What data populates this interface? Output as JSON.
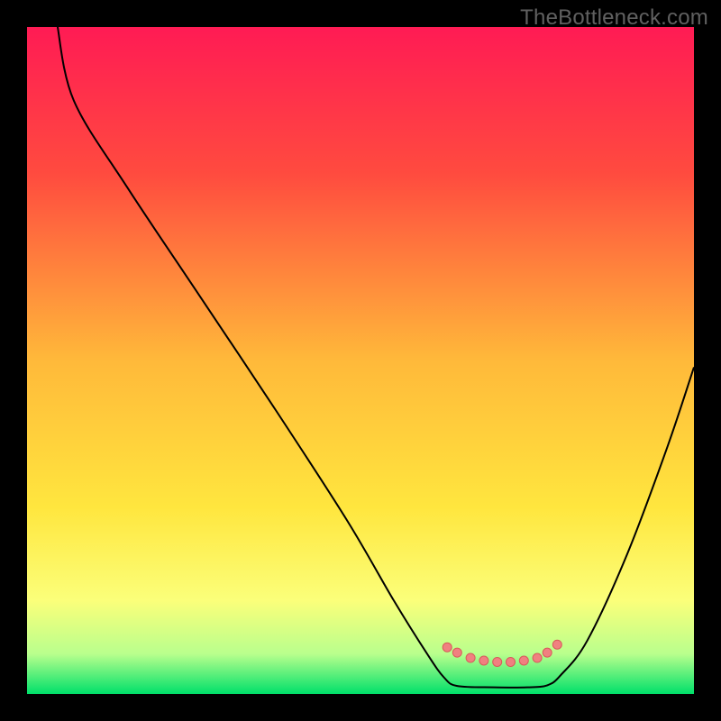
{
  "watermark": {
    "text": "TheBottleneck.com"
  },
  "chart_data": {
    "type": "line",
    "title": "",
    "xlabel": "",
    "ylabel": "",
    "xlim": [
      0,
      100
    ],
    "ylim": [
      0,
      100
    ],
    "background": {
      "type": "vertical-gradient",
      "stops": [
        {
          "pct": 0,
          "color": "#ff1b54"
        },
        {
          "pct": 22,
          "color": "#ff4b3f"
        },
        {
          "pct": 50,
          "color": "#ffb93a"
        },
        {
          "pct": 72,
          "color": "#ffe63e"
        },
        {
          "pct": 86,
          "color": "#fbff7a"
        },
        {
          "pct": 94,
          "color": "#b9ff8d"
        },
        {
          "pct": 100,
          "color": "#00e06a"
        }
      ]
    },
    "series": [
      {
        "name": "bottleneck-curve",
        "color": "#000000",
        "width": 2,
        "points": [
          {
            "x": 4.5,
            "y": 100.5
          },
          {
            "x": 7,
            "y": 89
          },
          {
            "x": 15,
            "y": 76
          },
          {
            "x": 25,
            "y": 61
          },
          {
            "x": 37,
            "y": 43
          },
          {
            "x": 48,
            "y": 26
          },
          {
            "x": 55,
            "y": 14
          },
          {
            "x": 60,
            "y": 6
          },
          {
            "x": 62.5,
            "y": 2.5
          },
          {
            "x": 64.5,
            "y": 1.2
          },
          {
            "x": 70,
            "y": 1.0
          },
          {
            "x": 75,
            "y": 1.0
          },
          {
            "x": 78,
            "y": 1.3
          },
          {
            "x": 80,
            "y": 2.8
          },
          {
            "x": 84,
            "y": 8
          },
          {
            "x": 90,
            "y": 21
          },
          {
            "x": 96,
            "y": 37
          },
          {
            "x": 100,
            "y": 49
          }
        ]
      }
    ],
    "markers": {
      "fill": "#f08080",
      "stroke": "#d85a5a",
      "radius": 5,
      "points": [
        {
          "x": 63,
          "y": 7
        },
        {
          "x": 64.5,
          "y": 6.2
        },
        {
          "x": 66.5,
          "y": 5.4
        },
        {
          "x": 68.5,
          "y": 5.0
        },
        {
          "x": 70.5,
          "y": 4.8
        },
        {
          "x": 72.5,
          "y": 4.8
        },
        {
          "x": 74.5,
          "y": 5.0
        },
        {
          "x": 76.5,
          "y": 5.4
        },
        {
          "x": 78,
          "y": 6.2
        },
        {
          "x": 79.5,
          "y": 7.4
        }
      ]
    }
  }
}
